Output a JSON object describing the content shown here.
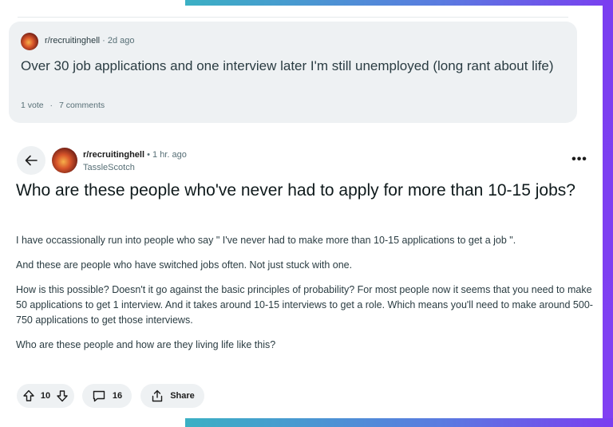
{
  "related_post": {
    "subreddit": "r/recruitinghell",
    "age": "2d ago",
    "title": "Over 30 job applications and one interview later I'm still unemployed (long rant about life)",
    "votes": "1 vote",
    "comments": "7 comments"
  },
  "post": {
    "subreddit": "r/recruitinghell",
    "age": "1 hr. ago",
    "author": "TassleScotch",
    "title": "Who are these people who've never had to apply for more than 10-15 jobs?",
    "paragraphs": [
      "I have occassionally run into people who say \" I've never had to make more than 10-15 applications to get a job \".",
      "And these are people who have switched jobs often. Not just stuck with one.",
      "How is this possible? Doesn't it go against the basic principles of probability? For most people now it seems that you need to make 50 applications to get 1 interview. And it takes around 10-15 interviews to get a role. Which means you'll need to make around 500-750 applications to get those interviews.",
      "Who are these people and how are they living life like this?"
    ],
    "more_icon": "•••"
  },
  "actions": {
    "score": "10",
    "comment_count": "16",
    "share_label": "Share"
  },
  "icons": {
    "back": "arrow-left-icon",
    "upvote": "arrow-up-icon",
    "downvote": "arrow-down-icon",
    "comment": "comment-bubble-icon",
    "share": "share-icon",
    "more": "more-dots-icon"
  },
  "colors": {
    "gradient_start": "#3bb0c4",
    "gradient_end": "#7a3ef0",
    "card_bg": "#eef1f3",
    "muted_text": "#576f76"
  }
}
